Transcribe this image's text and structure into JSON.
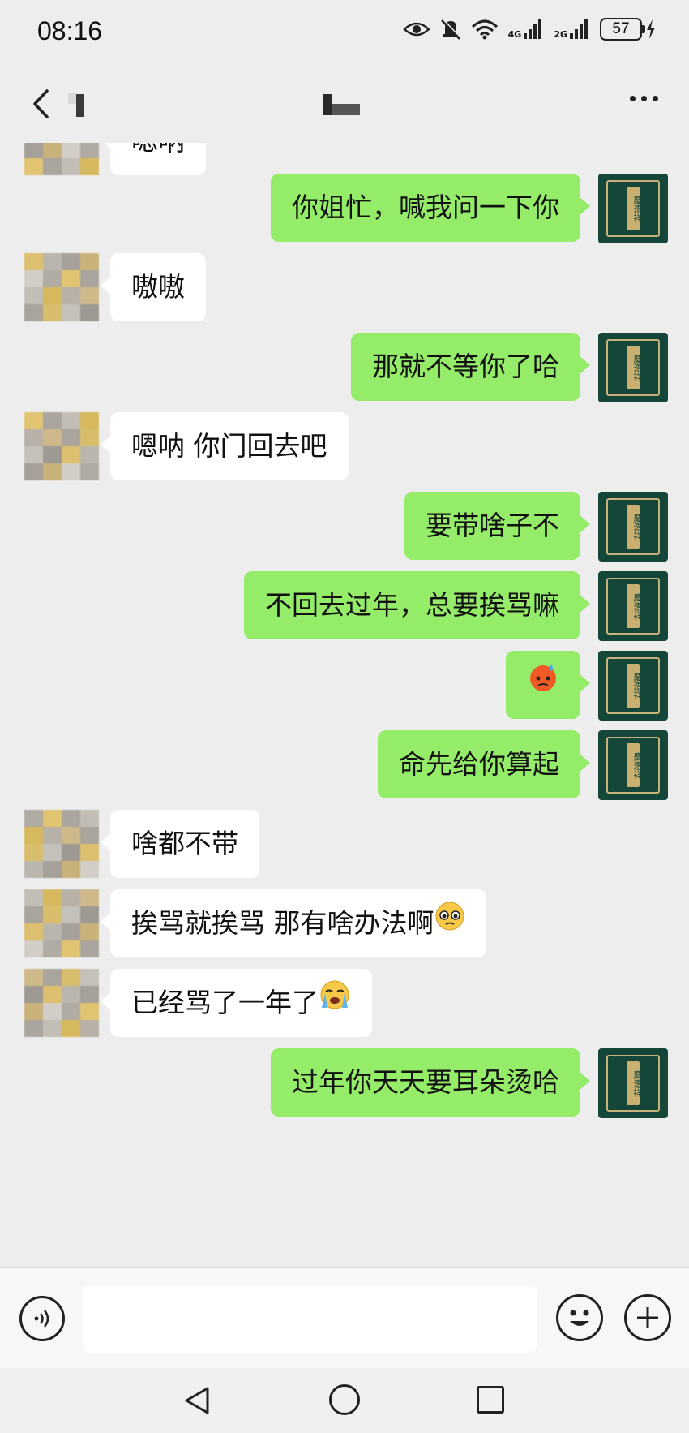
{
  "status_bar": {
    "time": "08:16",
    "net_4g": "4G",
    "net_2g": "2G",
    "battery": "57"
  },
  "header": {
    "back_icon": "chevron-left-icon",
    "more_icon": "more-dots-icon"
  },
  "messages": [
    {
      "side": "in",
      "text": "嗯呐"
    },
    {
      "side": "out",
      "text": "你姐忙，喊我问一下你"
    },
    {
      "side": "in",
      "text": "嗷嗷"
    },
    {
      "side": "out",
      "text": "那就不等你了哈"
    },
    {
      "side": "in",
      "text": "嗯呐   你门回去吧"
    },
    {
      "side": "out",
      "text": "要带啥子不"
    },
    {
      "side": "out",
      "text": "不回去过年，总要挨骂嘛"
    },
    {
      "side": "out",
      "text": "",
      "emoji": "cold-sweat-emoji"
    },
    {
      "side": "out",
      "text": "命先给你算起"
    },
    {
      "side": "in",
      "text": "啥都不带"
    },
    {
      "side": "in",
      "text": "挨骂就挨骂   那有啥办法啊",
      "emoji": "pleading-face-emoji"
    },
    {
      "side": "in",
      "text": "已经骂了一年了",
      "emoji": "loudly-crying-emoji"
    },
    {
      "side": "out",
      "text": "过年你天天要耳朵烫哈"
    }
  ],
  "self_avatar_text": "慶澧祥",
  "input": {
    "placeholder": "",
    "voice_icon": "voice-icon",
    "emoji_icon": "smiley-icon",
    "plus_icon": "plus-icon"
  },
  "colors": {
    "background": "#ededed",
    "outgoing_bubble": "#95ec69",
    "incoming_bubble": "#ffffff"
  }
}
